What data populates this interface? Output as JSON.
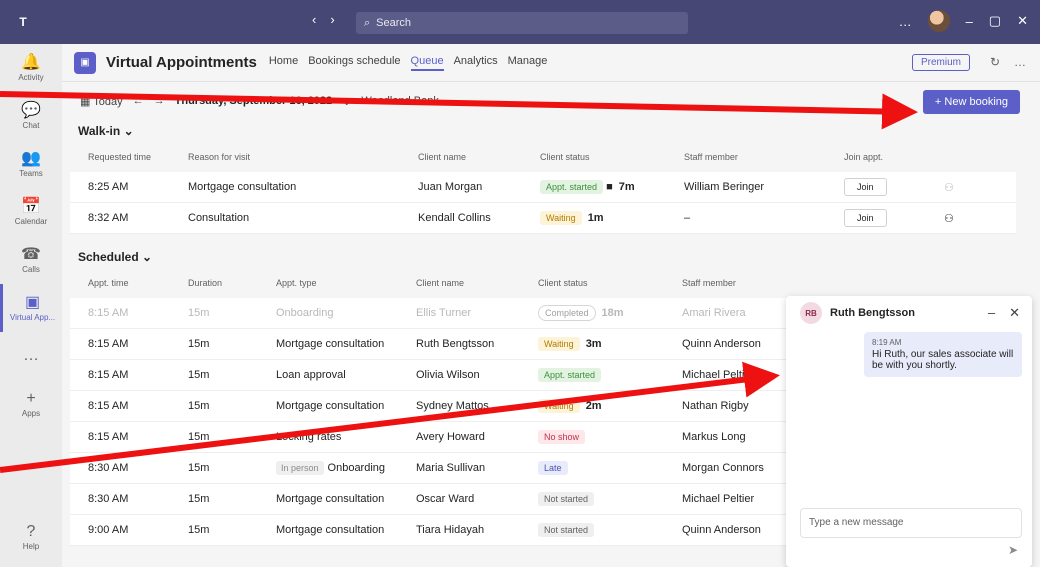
{
  "titlebar": {
    "search_placeholder": "Search",
    "nav": [
      "‹",
      "›"
    ],
    "controls": [
      "…",
      "–",
      "▢",
      "✕"
    ]
  },
  "rail": [
    {
      "label": "Activity",
      "icon": "bell-icon",
      "glyph": "🔔"
    },
    {
      "label": "Chat",
      "icon": "chat-icon",
      "glyph": "💬"
    },
    {
      "label": "Teams",
      "icon": "teams-icon",
      "glyph": "👥"
    },
    {
      "label": "Calendar",
      "icon": "calendar-icon",
      "glyph": "📅"
    },
    {
      "label": "Calls",
      "icon": "phone-icon",
      "glyph": "☎"
    },
    {
      "label": "Virtual App...",
      "icon": "virtual-appointments-icon",
      "glyph": "▣"
    },
    {
      "label": "",
      "icon": "more-icon",
      "glyph": "…"
    },
    {
      "label": "Apps",
      "icon": "plus-icon",
      "glyph": "+"
    }
  ],
  "help_label": "Help",
  "app": {
    "title": "Virtual Appointments",
    "tabs": [
      "Home",
      "Bookings schedule",
      "Queue",
      "Analytics",
      "Manage"
    ],
    "active_tab": "Queue",
    "premium": "Premium"
  },
  "toolbar": {
    "today": "Today",
    "date": "Thursday, September 16, 2022",
    "location": "Woodland Bank",
    "new_booking": "+ New booking"
  },
  "walkin": {
    "title": "Walk-in",
    "headers": [
      "Requested time",
      "Reason for visit",
      "Client name",
      "Client status",
      "Staff member",
      "Join appt."
    ],
    "rows": [
      {
        "time": "8:25 AM",
        "reason": "Mortgage consultation",
        "client": "Juan Morgan",
        "status": "Appt. started",
        "status_kind": "started",
        "dur": "7m",
        "staff": "William Beringer",
        "join": "Join"
      },
      {
        "time": "8:32 AM",
        "reason": "Consultation",
        "client": "Kendall Collins",
        "status": "Waiting",
        "status_kind": "waiting",
        "dur": "1m",
        "staff": "–",
        "join": "Join"
      }
    ]
  },
  "scheduled": {
    "title": "Scheduled",
    "headers": [
      "Appt. time",
      "Duration",
      "Appt. type",
      "Client name",
      "Client status",
      "Staff member"
    ],
    "rows": [
      {
        "time": "8:15 AM",
        "dur": "15m",
        "type": "Onboarding",
        "tag": "",
        "client": "Ellis Turner",
        "status": "Completed",
        "status_kind": "completed",
        "extra": "18m",
        "staff": "Amari Rivera",
        "muted": true
      },
      {
        "time": "8:15 AM",
        "dur": "15m",
        "type": "Mortgage consultation",
        "tag": "",
        "client": "Ruth Bengtsson",
        "status": "Waiting",
        "status_kind": "waiting",
        "extra": "3m",
        "staff": "Quinn Anderson",
        "muted": false
      },
      {
        "time": "8:15 AM",
        "dur": "15m",
        "type": "Loan approval",
        "tag": "",
        "client": "Olivia Wilson",
        "status": "Appt. started",
        "status_kind": "started",
        "extra": "",
        "staff": "Michael Peltier",
        "muted": false
      },
      {
        "time": "8:15 AM",
        "dur": "15m",
        "type": "Mortgage consultation",
        "tag": "",
        "client": "Sydney Mattos",
        "status": "Waiting",
        "status_kind": "waiting",
        "extra": "2m",
        "staff": "Nathan Rigby",
        "muted": false
      },
      {
        "time": "8:15 AM",
        "dur": "15m",
        "type": "Locking rates",
        "tag": "",
        "client": "Avery Howard",
        "status": "No show",
        "status_kind": "noshow",
        "extra": "",
        "staff": "Markus Long",
        "muted": false
      },
      {
        "time": "8:30 AM",
        "dur": "15m",
        "type": "Onboarding",
        "tag": "In person",
        "client": "Maria Sullivan",
        "status": "Late",
        "status_kind": "late",
        "extra": "",
        "staff": "Morgan Connors",
        "muted": false
      },
      {
        "time": "8:30 AM",
        "dur": "15m",
        "type": "Mortgage consultation",
        "tag": "",
        "client": "Oscar Ward",
        "status": "Not started",
        "status_kind": "ns",
        "extra": "",
        "staff": "Michael Peltier",
        "muted": false
      },
      {
        "time": "9:00 AM",
        "dur": "15m",
        "type": "Mortgage consultation",
        "tag": "",
        "client": "Tiara Hidayah",
        "status": "Not started",
        "status_kind": "ns",
        "extra": "",
        "staff": "Quinn Anderson",
        "muted": false
      }
    ]
  },
  "chat": {
    "initials": "RB",
    "name": "Ruth Bengtsson",
    "time": "8:19 AM",
    "message": "Hi Ruth, our sales associate will be with you shortly.",
    "placeholder": "Type a new message"
  },
  "colors": {
    "accent": "#5b5fc7",
    "arrow": "#ee1111",
    "titlebar": "#464775"
  }
}
